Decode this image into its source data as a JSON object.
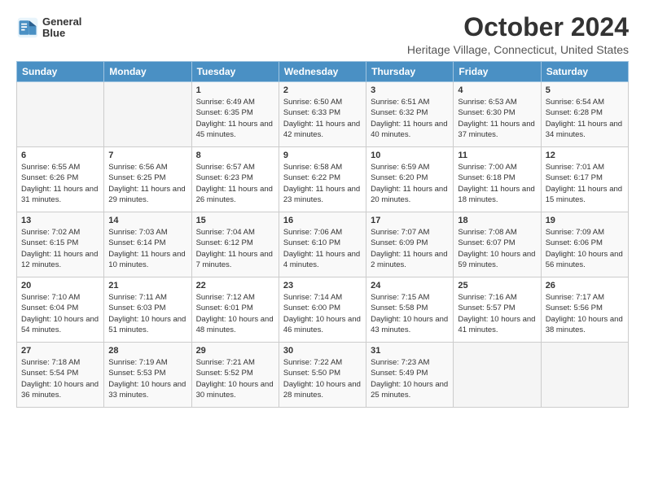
{
  "header": {
    "logo_text_line1": "General",
    "logo_text_line2": "Blue",
    "month": "October 2024",
    "location": "Heritage Village, Connecticut, United States"
  },
  "days_of_week": [
    "Sunday",
    "Monday",
    "Tuesday",
    "Wednesday",
    "Thursday",
    "Friday",
    "Saturday"
  ],
  "weeks": [
    [
      {
        "day": "",
        "sunrise": "",
        "sunset": "",
        "daylight": ""
      },
      {
        "day": "",
        "sunrise": "",
        "sunset": "",
        "daylight": ""
      },
      {
        "day": "1",
        "sunrise": "Sunrise: 6:49 AM",
        "sunset": "Sunset: 6:35 PM",
        "daylight": "Daylight: 11 hours and 45 minutes."
      },
      {
        "day": "2",
        "sunrise": "Sunrise: 6:50 AM",
        "sunset": "Sunset: 6:33 PM",
        "daylight": "Daylight: 11 hours and 42 minutes."
      },
      {
        "day": "3",
        "sunrise": "Sunrise: 6:51 AM",
        "sunset": "Sunset: 6:32 PM",
        "daylight": "Daylight: 11 hours and 40 minutes."
      },
      {
        "day": "4",
        "sunrise": "Sunrise: 6:53 AM",
        "sunset": "Sunset: 6:30 PM",
        "daylight": "Daylight: 11 hours and 37 minutes."
      },
      {
        "day": "5",
        "sunrise": "Sunrise: 6:54 AM",
        "sunset": "Sunset: 6:28 PM",
        "daylight": "Daylight: 11 hours and 34 minutes."
      }
    ],
    [
      {
        "day": "6",
        "sunrise": "Sunrise: 6:55 AM",
        "sunset": "Sunset: 6:26 PM",
        "daylight": "Daylight: 11 hours and 31 minutes."
      },
      {
        "day": "7",
        "sunrise": "Sunrise: 6:56 AM",
        "sunset": "Sunset: 6:25 PM",
        "daylight": "Daylight: 11 hours and 29 minutes."
      },
      {
        "day": "8",
        "sunrise": "Sunrise: 6:57 AM",
        "sunset": "Sunset: 6:23 PM",
        "daylight": "Daylight: 11 hours and 26 minutes."
      },
      {
        "day": "9",
        "sunrise": "Sunrise: 6:58 AM",
        "sunset": "Sunset: 6:22 PM",
        "daylight": "Daylight: 11 hours and 23 minutes."
      },
      {
        "day": "10",
        "sunrise": "Sunrise: 6:59 AM",
        "sunset": "Sunset: 6:20 PM",
        "daylight": "Daylight: 11 hours and 20 minutes."
      },
      {
        "day": "11",
        "sunrise": "Sunrise: 7:00 AM",
        "sunset": "Sunset: 6:18 PM",
        "daylight": "Daylight: 11 hours and 18 minutes."
      },
      {
        "day": "12",
        "sunrise": "Sunrise: 7:01 AM",
        "sunset": "Sunset: 6:17 PM",
        "daylight": "Daylight: 11 hours and 15 minutes."
      }
    ],
    [
      {
        "day": "13",
        "sunrise": "Sunrise: 7:02 AM",
        "sunset": "Sunset: 6:15 PM",
        "daylight": "Daylight: 11 hours and 12 minutes."
      },
      {
        "day": "14",
        "sunrise": "Sunrise: 7:03 AM",
        "sunset": "Sunset: 6:14 PM",
        "daylight": "Daylight: 11 hours and 10 minutes."
      },
      {
        "day": "15",
        "sunrise": "Sunrise: 7:04 AM",
        "sunset": "Sunset: 6:12 PM",
        "daylight": "Daylight: 11 hours and 7 minutes."
      },
      {
        "day": "16",
        "sunrise": "Sunrise: 7:06 AM",
        "sunset": "Sunset: 6:10 PM",
        "daylight": "Daylight: 11 hours and 4 minutes."
      },
      {
        "day": "17",
        "sunrise": "Sunrise: 7:07 AM",
        "sunset": "Sunset: 6:09 PM",
        "daylight": "Daylight: 11 hours and 2 minutes."
      },
      {
        "day": "18",
        "sunrise": "Sunrise: 7:08 AM",
        "sunset": "Sunset: 6:07 PM",
        "daylight": "Daylight: 10 hours and 59 minutes."
      },
      {
        "day": "19",
        "sunrise": "Sunrise: 7:09 AM",
        "sunset": "Sunset: 6:06 PM",
        "daylight": "Daylight: 10 hours and 56 minutes."
      }
    ],
    [
      {
        "day": "20",
        "sunrise": "Sunrise: 7:10 AM",
        "sunset": "Sunset: 6:04 PM",
        "daylight": "Daylight: 10 hours and 54 minutes."
      },
      {
        "day": "21",
        "sunrise": "Sunrise: 7:11 AM",
        "sunset": "Sunset: 6:03 PM",
        "daylight": "Daylight: 10 hours and 51 minutes."
      },
      {
        "day": "22",
        "sunrise": "Sunrise: 7:12 AM",
        "sunset": "Sunset: 6:01 PM",
        "daylight": "Daylight: 10 hours and 48 minutes."
      },
      {
        "day": "23",
        "sunrise": "Sunrise: 7:14 AM",
        "sunset": "Sunset: 6:00 PM",
        "daylight": "Daylight: 10 hours and 46 minutes."
      },
      {
        "day": "24",
        "sunrise": "Sunrise: 7:15 AM",
        "sunset": "Sunset: 5:58 PM",
        "daylight": "Daylight: 10 hours and 43 minutes."
      },
      {
        "day": "25",
        "sunrise": "Sunrise: 7:16 AM",
        "sunset": "Sunset: 5:57 PM",
        "daylight": "Daylight: 10 hours and 41 minutes."
      },
      {
        "day": "26",
        "sunrise": "Sunrise: 7:17 AM",
        "sunset": "Sunset: 5:56 PM",
        "daylight": "Daylight: 10 hours and 38 minutes."
      }
    ],
    [
      {
        "day": "27",
        "sunrise": "Sunrise: 7:18 AM",
        "sunset": "Sunset: 5:54 PM",
        "daylight": "Daylight: 10 hours and 36 minutes."
      },
      {
        "day": "28",
        "sunrise": "Sunrise: 7:19 AM",
        "sunset": "Sunset: 5:53 PM",
        "daylight": "Daylight: 10 hours and 33 minutes."
      },
      {
        "day": "29",
        "sunrise": "Sunrise: 7:21 AM",
        "sunset": "Sunset: 5:52 PM",
        "daylight": "Daylight: 10 hours and 30 minutes."
      },
      {
        "day": "30",
        "sunrise": "Sunrise: 7:22 AM",
        "sunset": "Sunset: 5:50 PM",
        "daylight": "Daylight: 10 hours and 28 minutes."
      },
      {
        "day": "31",
        "sunrise": "Sunrise: 7:23 AM",
        "sunset": "Sunset: 5:49 PM",
        "daylight": "Daylight: 10 hours and 25 minutes."
      },
      {
        "day": "",
        "sunrise": "",
        "sunset": "",
        "daylight": ""
      },
      {
        "day": "",
        "sunrise": "",
        "sunset": "",
        "daylight": ""
      }
    ]
  ]
}
